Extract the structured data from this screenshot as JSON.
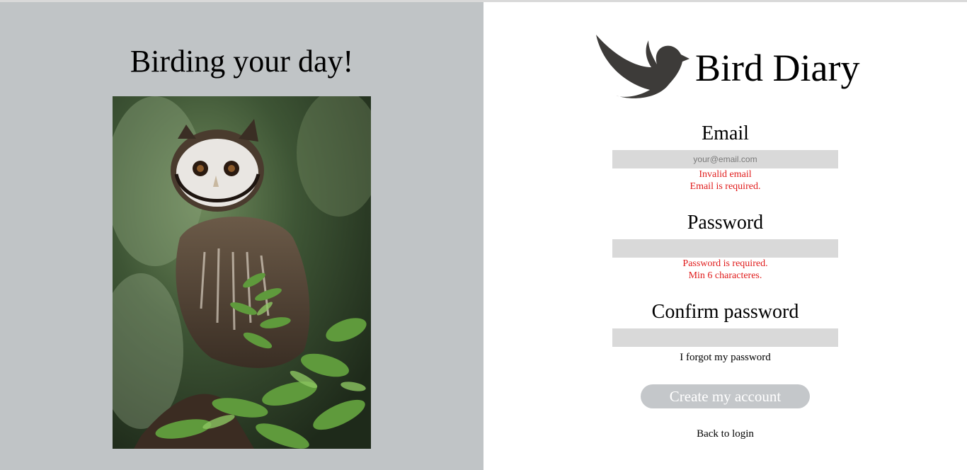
{
  "hero": {
    "headline": "Birding your day!",
    "image_alt": "owl-photo"
  },
  "brand": {
    "name": "Bird Diary",
    "logo_icon": "bird-logo-icon",
    "logo_color": "#3d3b39"
  },
  "form": {
    "email": {
      "label": "Email",
      "placeholder": "your@email.com",
      "value": "",
      "errors": [
        "Invalid email",
        "Email is required."
      ]
    },
    "password": {
      "label": "Password",
      "placeholder": "",
      "value": "",
      "errors": [
        "Password is required.",
        "Min 6 characteres."
      ]
    },
    "confirm_password": {
      "label": "Confirm password",
      "placeholder": "",
      "value": ""
    },
    "forgot_link": "I forgot my password",
    "submit_label": "Create my account",
    "back_link": "Back to login"
  },
  "colors": {
    "left_panel_bg": "#c0c4c6",
    "input_bg": "#d9d9d9",
    "error": "#e01b1b",
    "button_bg": "#c4c7ca"
  }
}
